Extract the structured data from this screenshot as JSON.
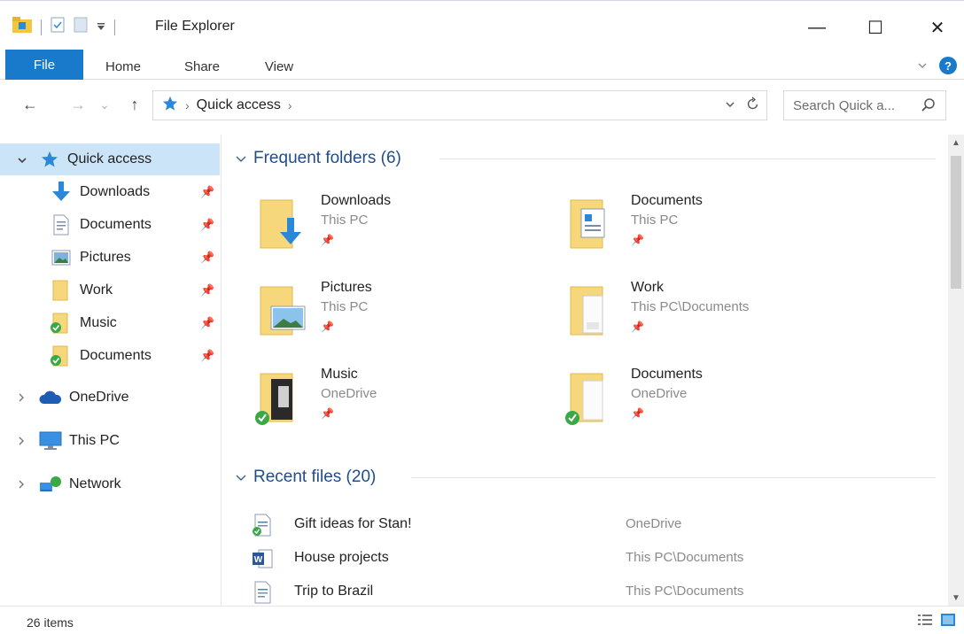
{
  "window": {
    "title": "File Explorer",
    "minimize_glyph": "—",
    "maximize_glyph": "☐",
    "close_glyph": "✕"
  },
  "ribbon": {
    "tabs": [
      "File",
      "Home",
      "Share",
      "View"
    ],
    "help_glyph": "?"
  },
  "nav": {
    "back_glyph": "←",
    "forward_glyph": "→",
    "recent_glyph": "⌄",
    "up_glyph": "↑"
  },
  "address": {
    "breadcrumb": [
      "Quick access"
    ]
  },
  "search": {
    "placeholder": "Search Quick a..."
  },
  "sidebar": {
    "quick_access": {
      "label": "Quick access",
      "items": [
        {
          "label": "Downloads",
          "icon": "download-icon"
        },
        {
          "label": "Documents",
          "icon": "document-icon"
        },
        {
          "label": "Pictures",
          "icon": "pictures-icon"
        },
        {
          "label": "Work",
          "icon": "folder-icon"
        },
        {
          "label": "Music",
          "icon": "folder-synced-icon"
        },
        {
          "label": "Documents",
          "icon": "folder-synced-icon"
        }
      ]
    },
    "locations": [
      {
        "label": "OneDrive",
        "icon": "cloud-icon"
      },
      {
        "label": "This PC",
        "icon": "monitor-icon"
      },
      {
        "label": "Network",
        "icon": "network-icon"
      }
    ]
  },
  "frequent": {
    "heading": "Frequent folders (6)",
    "folders": [
      {
        "name": "Downloads",
        "location": "This PC"
      },
      {
        "name": "Documents",
        "location": "This PC"
      },
      {
        "name": "Pictures",
        "location": "This PC"
      },
      {
        "name": "Work",
        "location": "This PC\\Documents"
      },
      {
        "name": "Music",
        "location": "OneDrive"
      },
      {
        "name": "Documents",
        "location": "OneDrive"
      }
    ]
  },
  "recent": {
    "heading": "Recent files (20)",
    "files": [
      {
        "name": "Gift ideas for Stan!",
        "location": "OneDrive"
      },
      {
        "name": "House projects",
        "location": "This PC\\Documents"
      },
      {
        "name": "Trip to Brazil",
        "location": "This PC\\Documents"
      }
    ]
  },
  "status": {
    "item_count": "26 items"
  },
  "colors": {
    "accent": "#1979ca",
    "selection": "#cce4f7",
    "group_heading": "#1e4e8c",
    "folder_yellow": "#f6d77c",
    "sync_green": "#3aa845"
  }
}
